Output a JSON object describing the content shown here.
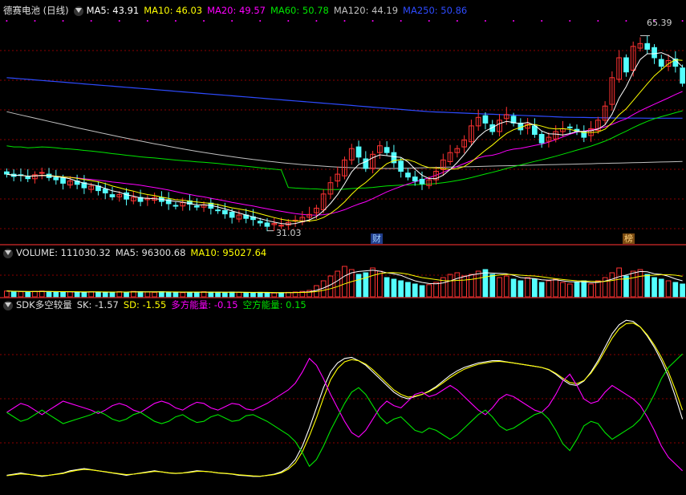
{
  "main_header": {
    "stock_name": "德赛电池 (日线)",
    "ma5": "MA5: 43.91",
    "ma10": "MA10: 46.03",
    "ma20": "MA20: 49.57",
    "ma60": "MA60: 50.78",
    "ma120": "MA120: 44.19",
    "ma250": "MA250: 50.86"
  },
  "volume_header": {
    "volume": "VOLUME: 111030.32",
    "ma5": "MA5: 96300.68",
    "ma10": "MA10: 95027.64"
  },
  "sdk_header": {
    "name": "SDK多空较量",
    "sk": "SK: -1.57",
    "sd": "SD: -1.55",
    "long_energy": "多方能量: -0.15",
    "short_energy": "空方能量: 0.15"
  },
  "markers": {
    "high_label": "65.39",
    "low_label": "31.03",
    "event_cai": "财",
    "event_bang": "榜"
  },
  "colors": {
    "up": "#ff3232",
    "down": "#54ffff",
    "ma5": "#ffffff",
    "ma10": "#ffff00",
    "ma20": "#ff00ff",
    "ma60": "#00e600",
    "ma120": "#c0c0c0",
    "ma250": "#2e4bff",
    "grid": "#8b0000",
    "divider": "#b22222"
  },
  "chart_data": [
    {
      "type": "candlestick",
      "ylim": [
        29,
        68
      ],
      "high_marker": 65.39,
      "low_marker": 31.03,
      "close": [
        41,
        40.6,
        40.8,
        40.2,
        40.9,
        41.3,
        40.4,
        40,
        39.4,
        39.8,
        39.2,
        38.6,
        38.9,
        38.1,
        37.7,
        37,
        37.4,
        36.6,
        36.9,
        36.2,
        36.7,
        36.9,
        36.2,
        35.8,
        35.4,
        36,
        35.7,
        35.2,
        35.6,
        35,
        34.6,
        34,
        33.4,
        33.8,
        33.2,
        33,
        32.4,
        31.8,
        32.3,
        32,
        32.5,
        32.9,
        33.4,
        33.9,
        35,
        37.5,
        39.5,
        41,
        43.5,
        45.5,
        44,
        42,
        44.5,
        46,
        44.8,
        43,
        41.5,
        40.5,
        39.8,
        39.3,
        40,
        41.5,
        43.5,
        44.8,
        45.5,
        47,
        49.5,
        51,
        50,
        48.5,
        50.5,
        51.5,
        50,
        48.8,
        49.8,
        48,
        46.5,
        47.5,
        48.5,
        49,
        49.2,
        48.5,
        47.5,
        49,
        50.5,
        53,
        58,
        61.5,
        59,
        63.5,
        64,
        63,
        61.5,
        60,
        61,
        60,
        57
      ],
      "ma250": [
        58,
        57.9,
        57.8,
        57.7,
        57.6,
        57.5,
        57.4,
        57.3,
        57.2,
        57.1,
        57,
        56.9,
        56.8,
        56.7,
        56.6,
        56.5,
        56.4,
        56.3,
        56.2,
        56.1,
        56,
        55.9,
        55.8,
        55.7,
        55.6,
        55.5,
        55.4,
        55.3,
        55.2,
        55.1,
        55,
        54.9,
        54.8,
        54.7,
        54.6,
        54.5,
        54.4,
        54.3,
        54.2,
        54.1,
        54,
        53.9,
        53.8,
        53.7,
        53.6,
        53.5,
        53.4,
        53.3,
        53.2,
        53.1,
        53,
        52.9,
        52.8,
        52.7,
        52.6,
        52.5,
        52.4,
        52.3,
        52.2,
        52.1,
        52,
        51.95,
        51.9,
        51.85,
        51.8,
        51.75,
        51.7,
        51.65,
        51.6,
        51.55,
        51.5,
        51.45,
        51.4,
        51.35,
        51.3,
        51.25,
        51.2,
        51.15,
        51.1,
        51.05,
        51.02,
        51,
        50.98,
        50.96,
        50.94,
        50.92,
        50.9,
        50.89,
        50.88,
        50.87,
        50.87,
        50.86,
        50.86,
        50.86,
        50.86,
        50.86,
        50.86
      ]
    },
    {
      "type": "bar",
      "title": "VOLUME",
      "values": [
        18,
        17,
        16,
        15,
        17,
        18,
        16,
        14,
        15,
        16,
        15,
        14,
        16,
        15,
        14,
        15,
        16,
        15,
        17,
        16,
        15,
        14,
        16,
        15,
        14,
        13,
        15,
        14,
        16,
        15,
        14,
        13,
        15,
        14,
        13,
        12,
        14,
        13,
        12,
        13,
        14,
        15,
        17,
        20,
        35,
        50,
        65,
        80,
        95,
        85,
        70,
        75,
        90,
        80,
        60,
        55,
        50,
        45,
        40,
        35,
        38,
        45,
        60,
        70,
        75,
        65,
        70,
        80,
        85,
        70,
        60,
        65,
        55,
        50,
        60,
        55,
        45,
        50,
        55,
        45,
        40,
        45,
        50,
        40,
        50,
        60,
        75,
        90,
        65,
        80,
        85,
        70,
        60,
        55,
        50,
        45,
        40
      ],
      "ylim": [
        0,
        120000
      ]
    },
    {
      "type": "line",
      "title": "SDK多空较量",
      "series": [
        {
          "name": "SK",
          "values": [
            -2.8,
            -2.75,
            -2.7,
            -2.75,
            -2.8,
            -2.85,
            -2.8,
            -2.75,
            -2.7,
            -2.6,
            -2.55,
            -2.5,
            -2.55,
            -2.6,
            -2.65,
            -2.7,
            -2.75,
            -2.8,
            -2.75,
            -2.7,
            -2.65,
            -2.6,
            -2.65,
            -2.7,
            -2.72,
            -2.7,
            -2.65,
            -2.6,
            -2.62,
            -2.65,
            -2.7,
            -2.72,
            -2.75,
            -2.8,
            -2.82,
            -2.85,
            -2.85,
            -2.8,
            -2.75,
            -2.65,
            -2.45,
            -2.1,
            -1.5,
            -0.7,
            0.2,
            1.1,
            1.8,
            2.2,
            2.4,
            2.45,
            2.3,
            2.1,
            1.8,
            1.5,
            1.2,
            0.9,
            0.7,
            0.6,
            0.7,
            0.8,
            0.95,
            1.15,
            1.4,
            1.65,
            1.85,
            2.0,
            2.1,
            2.2,
            2.25,
            2.3,
            2.3,
            2.25,
            2.2,
            2.15,
            2.1,
            2.05,
            2.0,
            1.9,
            1.7,
            1.45,
            1.25,
            1.2,
            1.4,
            1.8,
            2.3,
            2.9,
            3.5,
            3.9,
            4.1,
            4.05,
            3.8,
            3.4,
            2.9,
            2.3,
            1.6,
            0.7,
            -0.3
          ]
        },
        {
          "name": "SD",
          "values": [
            -2.82,
            -2.78,
            -2.74,
            -2.76,
            -2.79,
            -2.82,
            -2.8,
            -2.76,
            -2.72,
            -2.64,
            -2.58,
            -2.54,
            -2.56,
            -2.6,
            -2.64,
            -2.69,
            -2.73,
            -2.77,
            -2.75,
            -2.71,
            -2.67,
            -2.63,
            -2.65,
            -2.69,
            -2.71,
            -2.7,
            -2.67,
            -2.63,
            -2.63,
            -2.65,
            -2.69,
            -2.71,
            -2.74,
            -2.78,
            -2.8,
            -2.83,
            -2.84,
            -2.81,
            -2.77,
            -2.69,
            -2.53,
            -2.25,
            -1.75,
            -1.05,
            -0.25,
            0.65,
            1.45,
            1.95,
            2.25,
            2.35,
            2.3,
            2.15,
            1.9,
            1.6,
            1.3,
            1.0,
            0.8,
            0.68,
            0.72,
            0.8,
            0.93,
            1.1,
            1.32,
            1.55,
            1.75,
            1.92,
            2.04,
            2.14,
            2.2,
            2.25,
            2.27,
            2.24,
            2.2,
            2.15,
            2.1,
            2.05,
            2.0,
            1.91,
            1.74,
            1.52,
            1.33,
            1.28,
            1.42,
            1.75,
            2.2,
            2.75,
            3.3,
            3.72,
            3.95,
            3.98,
            3.8,
            3.45,
            3.0,
            2.45,
            1.8,
            1.0,
            0.1
          ]
        },
        {
          "name": "多方能量",
          "values": [
            0,
            0.2,
            0.4,
            0.3,
            0.1,
            -0.1,
            0.1,
            0.3,
            0.5,
            0.4,
            0.3,
            0.2,
            0.1,
            -0.05,
            0.1,
            0.3,
            0.4,
            0.3,
            0.1,
            0.0,
            0.2,
            0.4,
            0.5,
            0.4,
            0.2,
            0.1,
            0.3,
            0.45,
            0.4,
            0.2,
            0.1,
            0.25,
            0.4,
            0.35,
            0.15,
            0.1,
            0.25,
            0.4,
            0.6,
            0.8,
            1.0,
            1.3,
            1.8,
            2.4,
            2.1,
            1.5,
            0.8,
            0.2,
            -0.4,
            -0.9,
            -1.1,
            -0.8,
            -0.3,
            0.2,
            0.5,
            0.3,
            0.2,
            0.5,
            0.8,
            0.9,
            0.7,
            0.8,
            1.0,
            1.2,
            1.0,
            0.7,
            0.4,
            0.1,
            -0.1,
            0.2,
            0.6,
            0.8,
            0.7,
            0.5,
            0.3,
            0.1,
            0.0,
            0.3,
            0.8,
            1.4,
            1.7,
            1.2,
            0.6,
            0.4,
            0.5,
            0.9,
            1.2,
            1.0,
            0.8,
            0.6,
            0.3,
            -0.2,
            -0.8,
            -1.5,
            -2.0,
            -2.3,
            -2.6
          ]
        },
        {
          "name": "空方能量",
          "values": [
            0,
            -0.2,
            -0.4,
            -0.3,
            -0.1,
            0.1,
            -0.1,
            -0.3,
            -0.5,
            -0.4,
            -0.3,
            -0.2,
            -0.1,
            0.05,
            -0.1,
            -0.3,
            -0.4,
            -0.3,
            -0.1,
            0.0,
            -0.2,
            -0.4,
            -0.5,
            -0.4,
            -0.2,
            -0.1,
            -0.3,
            -0.45,
            -0.4,
            -0.2,
            -0.1,
            -0.25,
            -0.4,
            -0.35,
            -0.15,
            -0.1,
            -0.25,
            -0.4,
            -0.6,
            -0.8,
            -1.0,
            -1.3,
            -1.8,
            -2.4,
            -2.1,
            -1.5,
            -0.8,
            -0.2,
            0.4,
            0.9,
            1.1,
            0.8,
            0.3,
            -0.2,
            -0.5,
            -0.3,
            -0.2,
            -0.5,
            -0.8,
            -0.9,
            -0.7,
            -0.8,
            -1.0,
            -1.2,
            -1.0,
            -0.7,
            -0.4,
            -0.1,
            0.1,
            -0.2,
            -0.6,
            -0.8,
            -0.7,
            -0.5,
            -0.3,
            -0.1,
            0.0,
            -0.3,
            -0.8,
            -1.4,
            -1.7,
            -1.2,
            -0.6,
            -0.4,
            -0.5,
            -0.9,
            -1.2,
            -1.0,
            -0.8,
            -0.6,
            -0.3,
            0.2,
            0.8,
            1.5,
            2.0,
            2.3,
            2.6
          ]
        }
      ],
      "ylim": [
        -3.5,
        4.5
      ]
    }
  ]
}
